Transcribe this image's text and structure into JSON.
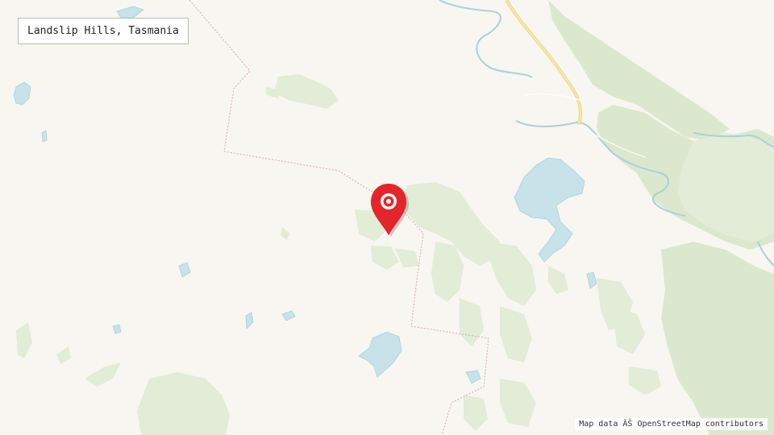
{
  "map": {
    "title": "Landslip Hills, Tasmania",
    "attribution": "Map data ÂŠ OpenStreetMap contributors",
    "marker_icon": "map-pin-icon"
  },
  "colors": {
    "land": "#f8f6f1",
    "forest": "#e2ecd6",
    "forest_dark": "#d6e4c6",
    "water": "#c8e2ea",
    "water_stroke": "#9fcad6",
    "road": "#f6e7a8",
    "road_stroke": "#e8d37c",
    "boundary": "#d7a9a9",
    "marker": "#e3262b"
  }
}
